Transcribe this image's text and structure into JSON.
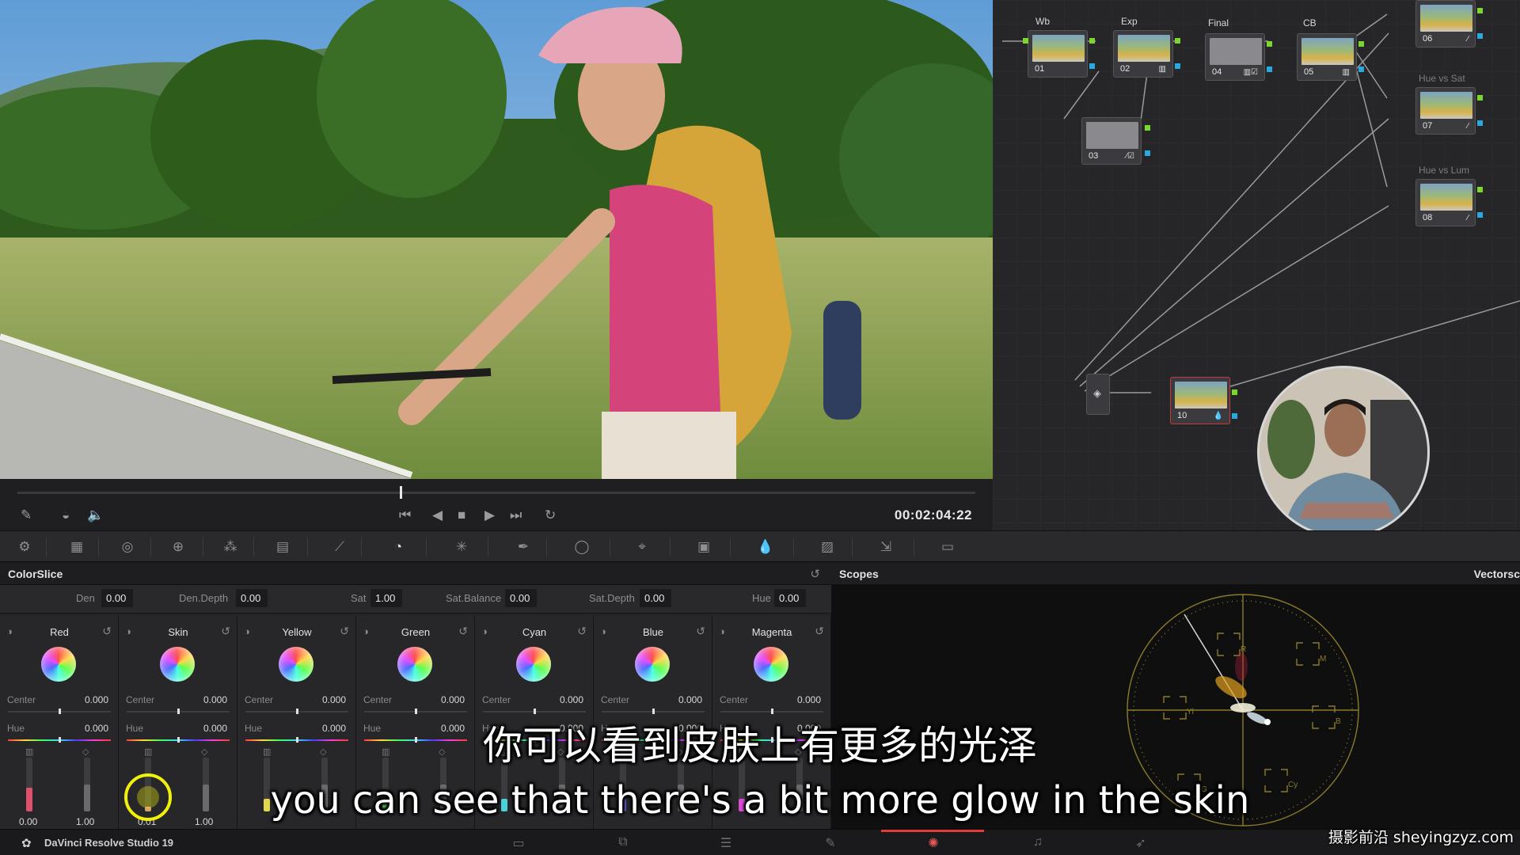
{
  "transport": {
    "timecode": "00:02:04:22",
    "playhead_fraction": 0.4
  },
  "node_graph": {
    "nodes": [
      {
        "id": "01",
        "title": "Wb"
      },
      {
        "id": "02",
        "title": "Exp"
      },
      {
        "id": "03",
        "title": ""
      },
      {
        "id": "04",
        "title": "Final"
      },
      {
        "id": "05",
        "title": "CB"
      },
      {
        "id": "06",
        "title": ""
      },
      {
        "id": "07",
        "title": "Hue vs Sat"
      },
      {
        "id": "08",
        "title": "Hue vs Lum"
      },
      {
        "id": "10",
        "title": ""
      }
    ]
  },
  "colorslice": {
    "title": "ColorSlice",
    "globals": [
      {
        "label": "Den",
        "value": "0.00"
      },
      {
        "label": "Den.Depth",
        "value": "0.00"
      },
      {
        "label": "Sat",
        "value": "1.00"
      },
      {
        "label": "Sat.Balance",
        "value": "0.00"
      },
      {
        "label": "Sat.Depth",
        "value": "0.00"
      },
      {
        "label": "Hue",
        "value": "0.00"
      }
    ],
    "vectors": [
      {
        "name": "Red",
        "center_label": "Center",
        "center": "0.000",
        "hue_label": "Hue",
        "hue": "0.000",
        "den": "0.00",
        "sat": "1.00",
        "color": "#e0506a"
      },
      {
        "name": "Skin",
        "center_label": "Center",
        "center": "0.000",
        "hue_label": "Hue",
        "hue": "0.000",
        "den": "0.01",
        "sat": "1.00",
        "color": "#d9a06a"
      },
      {
        "name": "Yellow",
        "center_label": "Center",
        "center": "0.000",
        "hue_label": "Hue",
        "hue": "0.000",
        "den": "",
        "sat": "",
        "color": "#e3d84a"
      },
      {
        "name": "Green",
        "center_label": "Center",
        "center": "0.000",
        "hue_label": "Hue",
        "hue": "0.000",
        "den": "",
        "sat": "",
        "color": "#5ad85a"
      },
      {
        "name": "Cyan",
        "center_label": "Center",
        "center": "0.000",
        "hue_label": "Hue",
        "hue": "0.000",
        "den": "",
        "sat": "",
        "color": "#4ad2d8"
      },
      {
        "name": "Blue",
        "center_label": "Center",
        "center": "0.000",
        "hue_label": "Hue",
        "hue": "0.000",
        "den": "",
        "sat": "",
        "color": "#6a6ae0"
      },
      {
        "name": "Magenta",
        "center_label": "Center",
        "center": "0.000",
        "hue_label": "Hue",
        "hue": "0.000",
        "den": "",
        "sat": "",
        "color": "#d84ad2"
      }
    ]
  },
  "scopes": {
    "title": "Scopes",
    "mode": "Vectorsc",
    "targets": [
      "R",
      "M",
      "B",
      "Cy",
      "G",
      "Yl"
    ]
  },
  "footer": {
    "brand": "DaVinci Resolve Studio 19",
    "active_page": "color"
  },
  "subtitles": {
    "chinese": "你可以看到皮肤上有更多的光泽",
    "english": "you can see that there's a bit more glow in the skin"
  },
  "watermark": "摄影前沿 sheyingzyz.com",
  "colors": {
    "accent": "#e23b3b",
    "node_green": "#7bd62e",
    "node_blue": "#2aa9e0",
    "highlight": "#f0f00a"
  }
}
